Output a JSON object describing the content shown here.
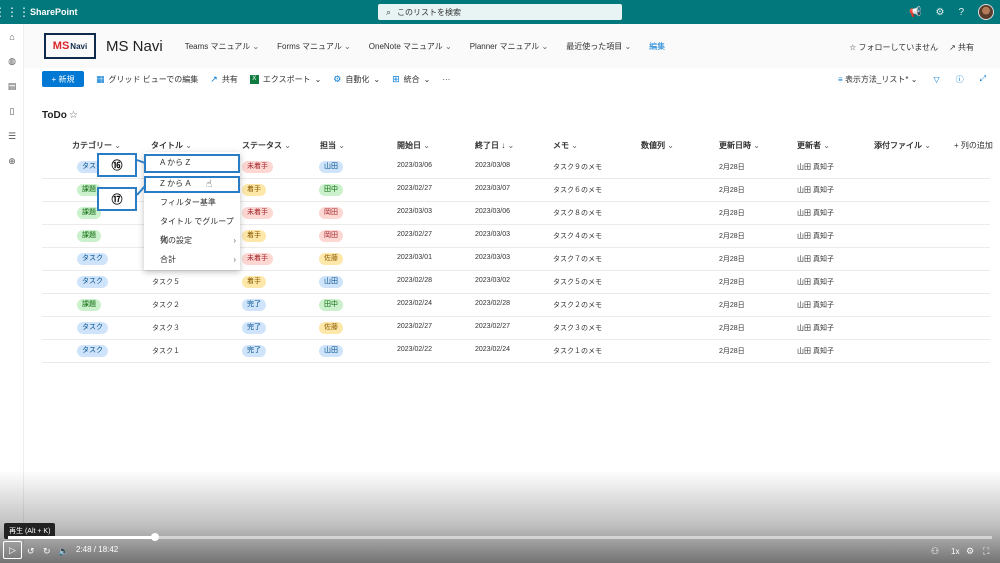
{
  "suite": {
    "brand": "SharePoint",
    "search_placeholder": "このリストを検索"
  },
  "site": {
    "logo_ms": "MS",
    "logo_navi": "Navi",
    "name": "MS Navi",
    "nav": [
      "Teams マニュアル",
      "Forms マニュアル",
      "OneNote マニュアル",
      "Planner マニュアル"
    ],
    "recent": "最近使った項目",
    "edit": "編集",
    "follow": "☆ フォローしていません",
    "share": "共有"
  },
  "commands": {
    "new": "+ 新規",
    "grid": "グリッド ビューでの編集",
    "share": "共有",
    "export": "エクスポート",
    "automate": "自動化",
    "integrate": "統合",
    "more": "···",
    "view": "表示方法_リスト*"
  },
  "list": {
    "title": "ToDo",
    "columns": {
      "category": "カテゴリー",
      "title": "タイトル",
      "status": "ステータス",
      "assignee": "担当",
      "start": "開始日",
      "end": "終了日 ↓",
      "memo": "メモ",
      "number": "数値列",
      "modified": "更新日時",
      "modified_by": "更新者",
      "attachment": "添付ファイル",
      "add_column": "+ 列の追加"
    },
    "rows": [
      {
        "category": "タスク",
        "cat_style": "task",
        "title": "",
        "status": "未着手",
        "st_style": "todo",
        "assignee": "山田",
        "as_style": "y",
        "start": "2023/03/06",
        "end": "2023/03/08",
        "memo": "タスク９のメモ",
        "modified": "2月28日",
        "by": "山田 真知子"
      },
      {
        "category": "課題",
        "cat_style": "issue",
        "title": "",
        "status": "着手",
        "st_style": "doing",
        "assignee": "田中",
        "as_style": "t",
        "start": "2023/02/27",
        "end": "2023/03/07",
        "memo": "タスク６のメモ",
        "modified": "2月28日",
        "by": "山田 真知子"
      },
      {
        "category": "課題",
        "cat_style": "issue",
        "title": "",
        "status": "未着手",
        "st_style": "todo",
        "assignee": "岡田",
        "as_style": "o",
        "start": "2023/03/03",
        "end": "2023/03/06",
        "memo": "タスク８のメモ",
        "modified": "2月28日",
        "by": "山田 真知子"
      },
      {
        "category": "課題",
        "cat_style": "issue",
        "title": "",
        "status": "着手",
        "st_style": "doing",
        "assignee": "岡田",
        "as_style": "o",
        "start": "2023/02/27",
        "end": "2023/03/03",
        "memo": "タスク４のメモ",
        "modified": "2月28日",
        "by": "山田 真知子"
      },
      {
        "category": "タスク",
        "cat_style": "task",
        "title": "",
        "status": "未着手",
        "st_style": "todo",
        "assignee": "佐藤",
        "as_style": "s",
        "start": "2023/03/01",
        "end": "2023/03/03",
        "memo": "タスク７のメモ",
        "modified": "2月28日",
        "by": "山田 真知子"
      },
      {
        "category": "タスク",
        "cat_style": "task",
        "title": "タスク５",
        "status": "着手",
        "st_style": "doing",
        "assignee": "山田",
        "as_style": "y",
        "start": "2023/02/28",
        "end": "2023/03/02",
        "memo": "タスク５のメモ",
        "modified": "2月28日",
        "by": "山田 真知子"
      },
      {
        "category": "課題",
        "cat_style": "issue",
        "title": "タスク２",
        "status": "完了",
        "st_style": "done",
        "assignee": "田中",
        "as_style": "t",
        "start": "2023/02/24",
        "end": "2023/02/28",
        "memo": "タスク２のメモ",
        "modified": "2月28日",
        "by": "山田 真知子"
      },
      {
        "category": "タスク",
        "cat_style": "task",
        "title": "タスク３",
        "status": "完了",
        "st_style": "done",
        "assignee": "佐藤",
        "as_style": "s",
        "start": "2023/02/27",
        "end": "2023/02/27",
        "memo": "タスク３のメモ",
        "modified": "2月28日",
        "by": "山田 真知子"
      },
      {
        "category": "タスク",
        "cat_style": "task",
        "title": "タスク１",
        "status": "完了",
        "st_style": "done",
        "assignee": "山田",
        "as_style": "y",
        "start": "2023/02/22",
        "end": "2023/02/24",
        "memo": "タスク１のメモ",
        "modified": "2月28日",
        "by": "山田 真知子"
      }
    ]
  },
  "menu": {
    "items": [
      "A から Z",
      "Z から A",
      "フィルター基準",
      "タイトル でグループ化",
      "列の設定",
      "合計"
    ],
    "badges": [
      "⑯",
      "⑰"
    ]
  },
  "player": {
    "tooltip": "再生 (Alt + K)",
    "time": "2:48 / 18:42",
    "speed": "1x",
    "progress": 0.149
  }
}
